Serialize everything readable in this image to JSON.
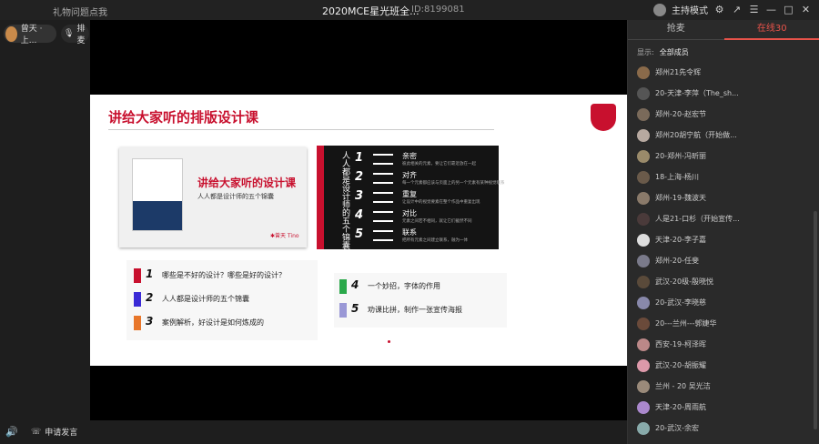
{
  "topbar": {
    "left_text": "礼物问题点我",
    "title": "2020MCE星光班全...",
    "room_id": "ID:8199081",
    "host_mode": "主持模式"
  },
  "left": {
    "presenter_label": "曾天 · 上...",
    "mic_label": "排麦"
  },
  "slide": {
    "title": "讲给大家听的排版设计课",
    "book_title": "讲给大家听的设计课",
    "book_subtitle": "人人都是设计师的五个锦囊",
    "book_author": "✱曾天 Tino",
    "dark_vertical": "人人都是设计师的五个锦囊",
    "principles": [
      {
        "num": "1",
        "label": "亲密",
        "desc": "彼此相关的元素，要让它们靠近放在一起"
      },
      {
        "num": "2",
        "label": "对齐",
        "desc": "每一个元素都应该与页面上的另一个元素有某种视觉联系"
      },
      {
        "num": "3",
        "label": "重复",
        "desc": "让设计中的视觉要素在整个作品中重复出现"
      },
      {
        "num": "4",
        "label": "对比",
        "desc": "元素之间若不相同，就让它们截然不同"
      },
      {
        "num": "5",
        "label": "联系",
        "desc": "把所有元素之间建立联系，融为一体"
      }
    ],
    "points_left": [
      {
        "num": "1",
        "text": "哪些是不好的设计？哪些是好的设计？",
        "color": "#c8102e"
      },
      {
        "num": "2",
        "text": "人人都是设计师的五个锦囊",
        "color": "#3a2ad6"
      },
      {
        "num": "3",
        "text": "案例解析，好设计是如何炼成的",
        "color": "#e8762a"
      }
    ],
    "points_right": [
      {
        "num": "4",
        "text": "一个妙招，字体的作用",
        "color": "#2aa84a"
      },
      {
        "num": "5",
        "text": "劝课比拼，制作一张宣传海报",
        "color": "#9a98d6"
      }
    ]
  },
  "bottom": {
    "apply_label": "申请发言"
  },
  "sidebar": {
    "tabs": [
      "抢麦",
      "在线30"
    ],
    "filter_label": "显示:",
    "filter_value": "全部成员",
    "members": [
      {
        "name": "郑州21先令辉",
        "color": "#8a6a4a"
      },
      {
        "name": "20-天津-李萍（The_sh...",
        "color": "#555"
      },
      {
        "name": "郑州-20-赵宏节",
        "color": "#7a6a5a"
      },
      {
        "name": "郑州20胡宁航（开始做...",
        "color": "#b7a9a0"
      },
      {
        "name": "20-郑州-冯昕丽",
        "color": "#9a8a6a"
      },
      {
        "name": "18-上海-杨川",
        "color": "#6a5a4a"
      },
      {
        "name": "郑州-19-魏波天",
        "color": "#8a7a6a"
      },
      {
        "name": "人是21-口杉（开始宣传...",
        "color": "#4a3a3a"
      },
      {
        "name": "天津-20-李子嘉",
        "color": "#ddd"
      },
      {
        "name": "郑州-20-任斐",
        "color": "#7a7a8a"
      },
      {
        "name": "武汉-20级-殷晓悦",
        "color": "#5a4a3a"
      },
      {
        "name": "20-武汉-李晓慈",
        "color": "#88a"
      },
      {
        "name": "20---兰州---郭婕华",
        "color": "#6a4a3a"
      },
      {
        "name": "西安-19-柯泽晖",
        "color": "#b88"
      },
      {
        "name": "武汉-20-胡振耀",
        "color": "#d9a"
      },
      {
        "name": "兰州 - 20 吴光洁",
        "color": "#9a8a7a"
      },
      {
        "name": "天津-20-周雨航",
        "color": "#a8c"
      },
      {
        "name": "20-武汉-余宏",
        "color": "#8aa"
      }
    ]
  }
}
